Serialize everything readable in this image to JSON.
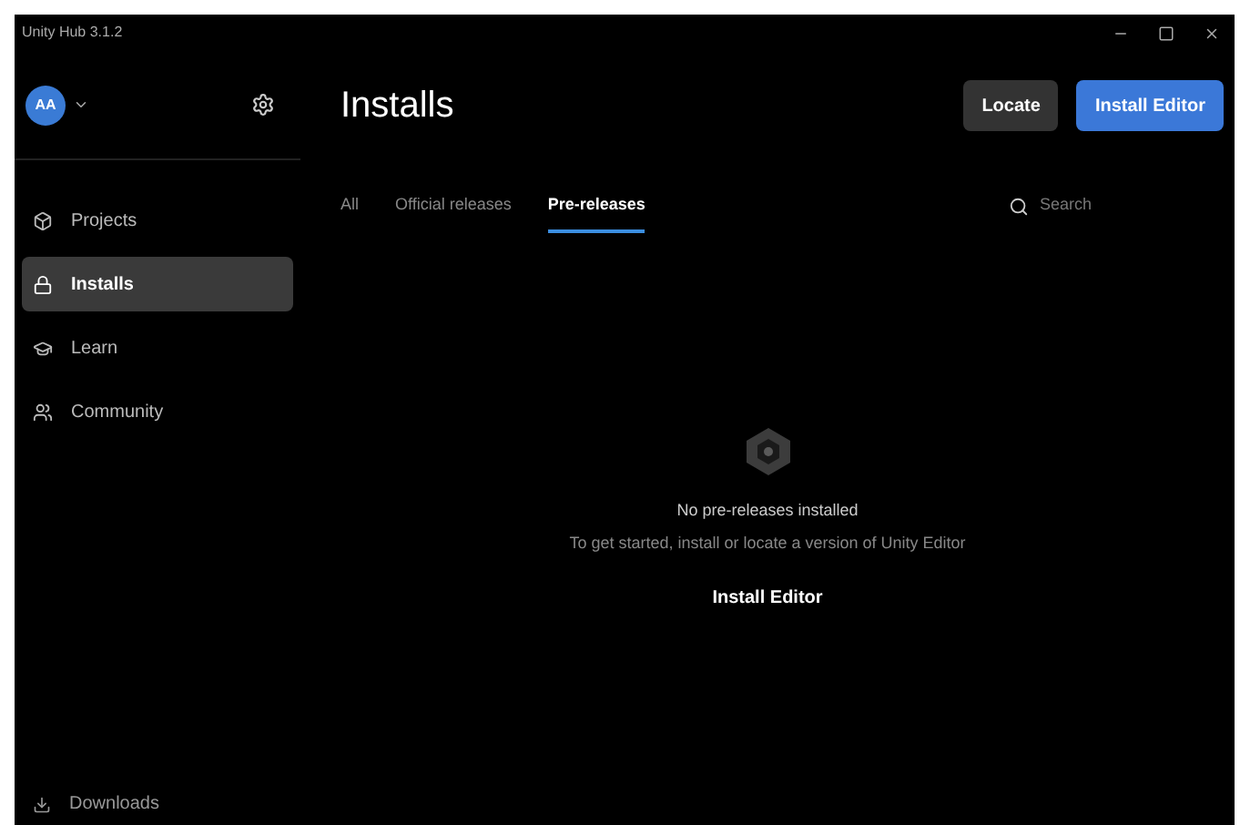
{
  "window": {
    "title": "Unity Hub 3.1.2"
  },
  "account": {
    "initials": "AA"
  },
  "sidebar": {
    "items": [
      {
        "label": "Projects",
        "selected": false
      },
      {
        "label": "Installs",
        "selected": true
      },
      {
        "label": "Learn",
        "selected": false
      },
      {
        "label": "Community",
        "selected": false
      }
    ],
    "footer": {
      "label": "Downloads"
    }
  },
  "page": {
    "title": "Installs",
    "buttons": [
      {
        "label": "Locate",
        "kind": "secondary"
      },
      {
        "label": "Install Editor",
        "kind": "primary"
      }
    ]
  },
  "tabs": [
    {
      "label": "All",
      "selected": false
    },
    {
      "label": "Official releases",
      "selected": false
    },
    {
      "label": "Pre-releases",
      "selected": true
    }
  ],
  "search": {
    "placeholder": "Search"
  },
  "empty_state": {
    "title": "No pre-releases installed",
    "message": "To get started, install or locate a version of Unity Editor",
    "action": "Install Editor"
  }
}
